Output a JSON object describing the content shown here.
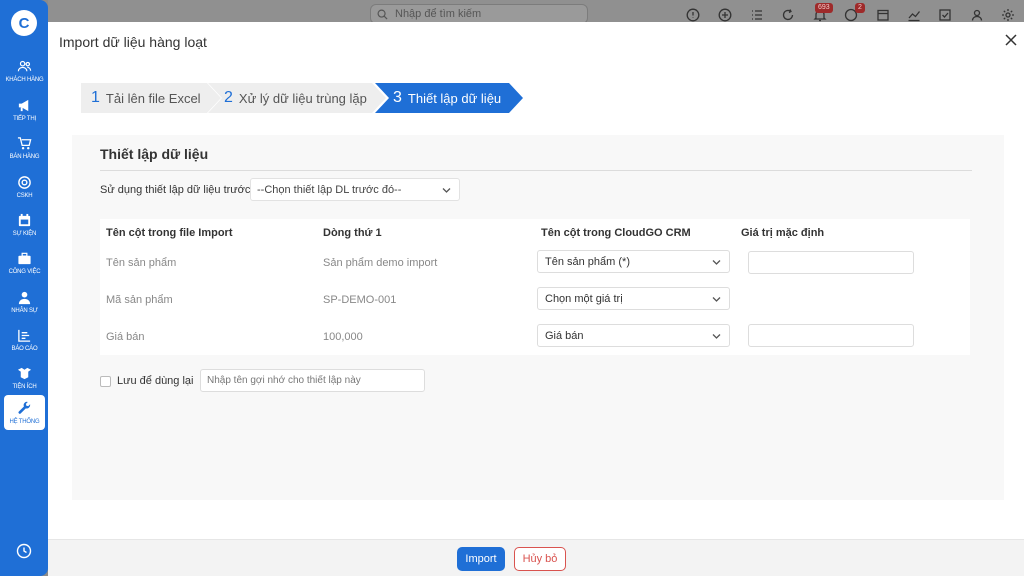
{
  "sidebar": {
    "logo": "C",
    "items": [
      {
        "label": "KHÁCH HÀNG",
        "icon": "users-icon"
      },
      {
        "label": "TIẾP THỊ",
        "icon": "megaphone-icon"
      },
      {
        "label": "BÁN HÀNG",
        "icon": "cart-icon"
      },
      {
        "label": "CSKH",
        "icon": "support-icon"
      },
      {
        "label": "SỰ KIỆN",
        "icon": "calendar-icon"
      },
      {
        "label": "CÔNG VIỆC",
        "icon": "briefcase-icon"
      },
      {
        "label": "NHÂN SỰ",
        "icon": "person-icon"
      },
      {
        "label": "BÁO CÁO",
        "icon": "report-icon"
      },
      {
        "label": "TIỆN ÍCH",
        "icon": "box-icon"
      },
      {
        "label": "HỆ THỐNG",
        "icon": "wrench-icon",
        "active": true
      }
    ]
  },
  "topbar": {
    "search_placeholder": "Nhập để tìm kiếm",
    "notification_count": "693",
    "chat_count": "2"
  },
  "modal": {
    "title": "Import dữ liệu hàng loạt",
    "steps": [
      {
        "num": "1",
        "label": "Tải lên file Excel"
      },
      {
        "num": "2",
        "label": "Xử lý dữ liệu trùng lặp"
      },
      {
        "num": "3",
        "label": "Thiết lập dữ liệu",
        "active": true
      }
    ],
    "section_title": "Thiết lập dữ liệu",
    "preset_label": "Sử dụng thiết lập dữ liệu trước",
    "preset_value": "--Chọn thiết lập DL trước đó--",
    "table": {
      "headers": [
        "Tên cột trong file Import",
        "Dòng thứ 1",
        "Tên cột trong CloudGO CRM",
        "Giá trị mặc định"
      ],
      "rows": [
        {
          "import_col": "Tên sản phẩm",
          "row1": "Sản phẩm demo import",
          "crm_field": "Tên sản phẩm  (*)",
          "default": ""
        },
        {
          "import_col": "Mã sản phẩm",
          "row1": "SP-DEMO-001",
          "crm_field": "Chọn một giá trị"
        },
        {
          "import_col": "Giá bán",
          "row1": "100,000",
          "crm_field": "Giá bán",
          "default": ""
        }
      ]
    },
    "save_label": "Lưu để dùng lại",
    "save_placeholder": "Nhập tên gợi nhớ cho thiết lập này",
    "import_button": "Import",
    "cancel_button": "Hủy bỏ"
  },
  "colors": {
    "accent": "#1f6fd6",
    "danger": "#d9534f"
  }
}
